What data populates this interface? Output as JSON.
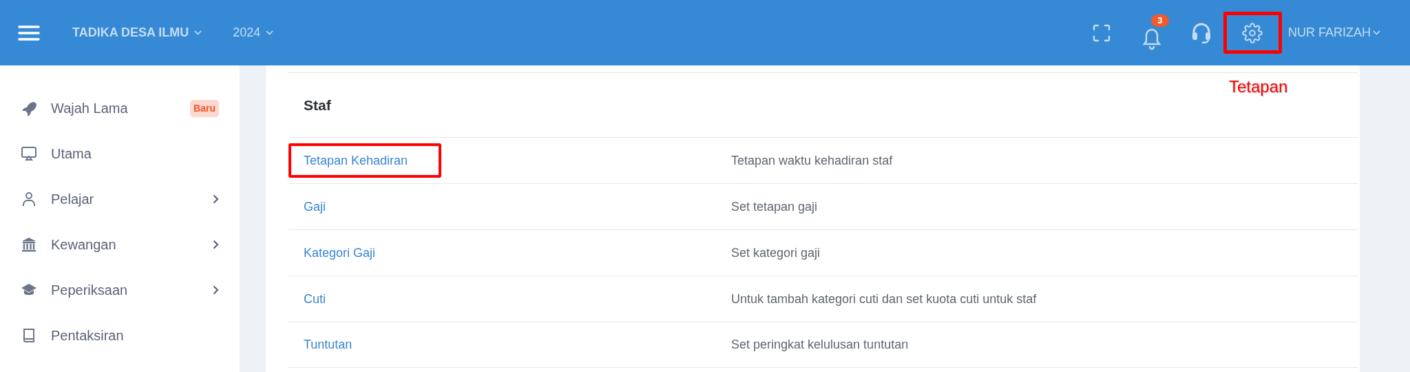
{
  "header": {
    "school": "TADIKA DESA ILMU",
    "year": "2024",
    "notifications": "3",
    "settings_highlighted": true,
    "user": "NUR FARIZAH"
  },
  "annotation": "Tetapan",
  "sidebar": {
    "items": [
      {
        "label": "Wajah Lama",
        "badge": "Baru",
        "expandable": false
      },
      {
        "label": "Utama",
        "expandable": false
      },
      {
        "label": "Pelajar",
        "expandable": true
      },
      {
        "label": "Kewangan",
        "expandable": true
      },
      {
        "label": "Peperiksaan",
        "expandable": true
      },
      {
        "label": "Pentaksiran",
        "expandable": false
      }
    ]
  },
  "section": {
    "title": "Staf",
    "rows": [
      {
        "name": "Tetapan Kehadiran",
        "description": "Tetapan waktu kehadiran staf",
        "highlighted": true
      },
      {
        "name": "Gaji",
        "description": "Set tetapan gaji",
        "highlighted": false
      },
      {
        "name": "Kategori Gaji",
        "description": "Set kategori gaji",
        "highlighted": false
      },
      {
        "name": "Cuti",
        "description": "Untuk tambah kategori cuti dan set kuota cuti untuk staf",
        "highlighted": false
      },
      {
        "name": "Tuntutan",
        "description": "Set peringkat kelulusan tuntutan",
        "highlighted": false
      }
    ]
  }
}
